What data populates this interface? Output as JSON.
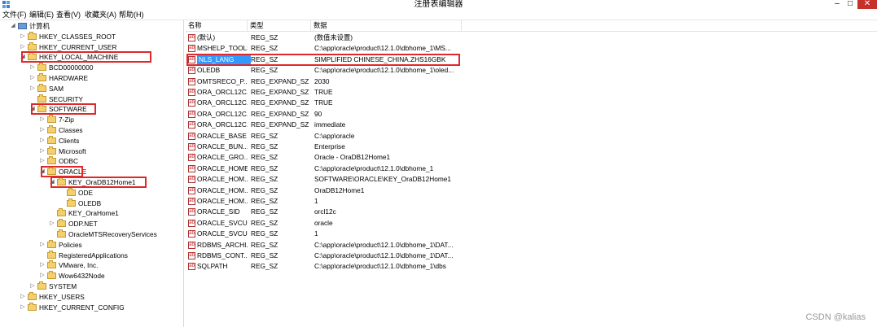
{
  "window": {
    "title": "注册表编辑器",
    "minimize": "–",
    "maximize": "□",
    "close": "✕"
  },
  "menu": [
    "文件(F)",
    "编辑(E)",
    "查看(V)",
    "收藏夹(A)",
    "帮助(H)"
  ],
  "tree": [
    {
      "label": "计算机",
      "icon": "computer-icon",
      "arrow": "◢",
      "level": 0,
      "name": "tree-node-computer"
    },
    {
      "label": "HKEY_CLASSES_ROOT",
      "arrow": "▷",
      "level": 1,
      "name": "tree-node-hkey-classes-root"
    },
    {
      "label": "HKEY_CURRENT_USER",
      "arrow": "▷",
      "level": 1,
      "name": "tree-node-hkey-current-user"
    },
    {
      "label": "HKEY_LOCAL_MACHINE",
      "arrow": "◢",
      "level": 1,
      "name": "tree-node-hkey-local-machine"
    },
    {
      "label": "BCD00000000",
      "arrow": "▷",
      "level": 2,
      "name": "tree-node-bcd"
    },
    {
      "label": "HARDWARE",
      "arrow": "▷",
      "level": 2,
      "name": "tree-node-hardware"
    },
    {
      "label": "SAM",
      "arrow": "▷",
      "level": 2,
      "name": "tree-node-sam"
    },
    {
      "label": "SECURITY",
      "arrow": "",
      "level": 2,
      "name": "tree-node-security"
    },
    {
      "label": "SOFTWARE",
      "arrow": "◢",
      "level": 2,
      "name": "tree-node-software"
    },
    {
      "label": "7-Zip",
      "arrow": "▷",
      "level": 3,
      "name": "tree-node-7zip"
    },
    {
      "label": "Classes",
      "arrow": "▷",
      "level": 3,
      "name": "tree-node-classes"
    },
    {
      "label": "Clients",
      "arrow": "▷",
      "level": 3,
      "name": "tree-node-clients"
    },
    {
      "label": "Microsoft",
      "arrow": "▷",
      "level": 3,
      "name": "tree-node-microsoft"
    },
    {
      "label": "ODBC",
      "arrow": "▷",
      "level": 3,
      "name": "tree-node-odbc"
    },
    {
      "label": "ORACLE",
      "arrow": "◢",
      "level": 3,
      "name": "tree-node-oracle"
    },
    {
      "label": "KEY_OraDB12Home1",
      "arrow": "◢",
      "level": 4,
      "name": "tree-node-key-oradb12home1"
    },
    {
      "label": "ODE",
      "arrow": "",
      "level": 5,
      "name": "tree-node-ode"
    },
    {
      "label": "OLEDB",
      "arrow": "",
      "level": 5,
      "name": "tree-node-oledb"
    },
    {
      "label": "KEY_OraHome1",
      "arrow": "",
      "level": 4,
      "name": "tree-node-key-orahome1"
    },
    {
      "label": "ODP.NET",
      "arrow": "▷",
      "level": 4,
      "name": "tree-node-odp-net"
    },
    {
      "label": "OracleMTSRecoveryServices",
      "arrow": "",
      "level": 4,
      "name": "tree-node-oracle-mts"
    },
    {
      "label": "Policies",
      "arrow": "▷",
      "level": 3,
      "name": "tree-node-policies"
    },
    {
      "label": "RegisteredApplications",
      "arrow": "",
      "level": 3,
      "name": "tree-node-registered-apps"
    },
    {
      "label": "VMware, Inc.",
      "arrow": "▷",
      "level": 3,
      "name": "tree-node-vmware"
    },
    {
      "label": "Wow6432Node",
      "arrow": "▷",
      "level": 3,
      "name": "tree-node-wow6432"
    },
    {
      "label": "SYSTEM",
      "arrow": "▷",
      "level": 2,
      "name": "tree-node-system"
    },
    {
      "label": "HKEY_USERS",
      "arrow": "▷",
      "level": 1,
      "name": "tree-node-hkey-users"
    },
    {
      "label": "HKEY_CURRENT_CONFIG",
      "arrow": "▷",
      "level": 1,
      "name": "tree-node-hkey-current-config"
    }
  ],
  "columns": [
    "名称",
    "类型",
    "数据"
  ],
  "values": [
    {
      "name": "(默认)",
      "type": "REG_SZ",
      "data": "(数值未设置)"
    },
    {
      "name": "MSHELP_TOOLS",
      "type": "REG_SZ",
      "data": "C:\\app\\oracle\\product\\12.1.0\\dbhome_1\\MS..."
    },
    {
      "name": "NLS_LANG",
      "type": "REG_SZ",
      "data": "SIMPLIFIED CHINESE_CHINA.ZHS16GBK",
      "selected": true
    },
    {
      "name": "OLEDB",
      "type": "REG_SZ",
      "data": "C:\\app\\oracle\\product\\12.1.0\\dbhome_1\\oled..."
    },
    {
      "name": "OMTSRECO_P...",
      "type": "REG_EXPAND_SZ",
      "data": "2030"
    },
    {
      "name": "ORA_ORCL12C...",
      "type": "REG_EXPAND_SZ",
      "data": "TRUE"
    },
    {
      "name": "ORA_ORCL12C...",
      "type": "REG_EXPAND_SZ",
      "data": "TRUE"
    },
    {
      "name": "ORA_ORCL12C...",
      "type": "REG_EXPAND_SZ",
      "data": "90"
    },
    {
      "name": "ORA_ORCL12C...",
      "type": "REG_EXPAND_SZ",
      "data": "immediate"
    },
    {
      "name": "ORACLE_BASE",
      "type": "REG_SZ",
      "data": "C:\\app\\oracle"
    },
    {
      "name": "ORACLE_BUN...",
      "type": "REG_SZ",
      "data": "Enterprise"
    },
    {
      "name": "ORACLE_GRO...",
      "type": "REG_SZ",
      "data": "Oracle - OraDB12Home1"
    },
    {
      "name": "ORACLE_HOME",
      "type": "REG_SZ",
      "data": "C:\\app\\oracle\\product\\12.1.0\\dbhome_1"
    },
    {
      "name": "ORACLE_HOM...",
      "type": "REG_SZ",
      "data": "SOFTWARE\\ORACLE\\KEY_OraDB12Home1"
    },
    {
      "name": "ORACLE_HOM...",
      "type": "REG_SZ",
      "data": "OraDB12Home1"
    },
    {
      "name": "ORACLE_HOM...",
      "type": "REG_SZ",
      "data": "1"
    },
    {
      "name": "ORACLE_SID",
      "type": "REG_SZ",
      "data": "orcl12c"
    },
    {
      "name": "ORACLE_SVCU...",
      "type": "REG_SZ",
      "data": "oracle"
    },
    {
      "name": "ORACLE_SVCU...",
      "type": "REG_SZ",
      "data": "1"
    },
    {
      "name": "RDBMS_ARCHI...",
      "type": "REG_SZ",
      "data": "C:\\app\\oracle\\product\\12.1.0\\dbhome_1\\DAT..."
    },
    {
      "name": "RDBMS_CONT...",
      "type": "REG_SZ",
      "data": "C:\\app\\oracle\\product\\12.1.0\\dbhome_1\\DAT..."
    },
    {
      "name": "SQLPATH",
      "type": "REG_SZ",
      "data": "C:\\app\\oracle\\product\\12.1.0\\dbhome_1\\dbs"
    }
  ],
  "watermark": "CSDN @kalias",
  "colors": {
    "highlight_box": "#e0272a",
    "selection": "#3399ff",
    "close_button": "#c7312b"
  }
}
